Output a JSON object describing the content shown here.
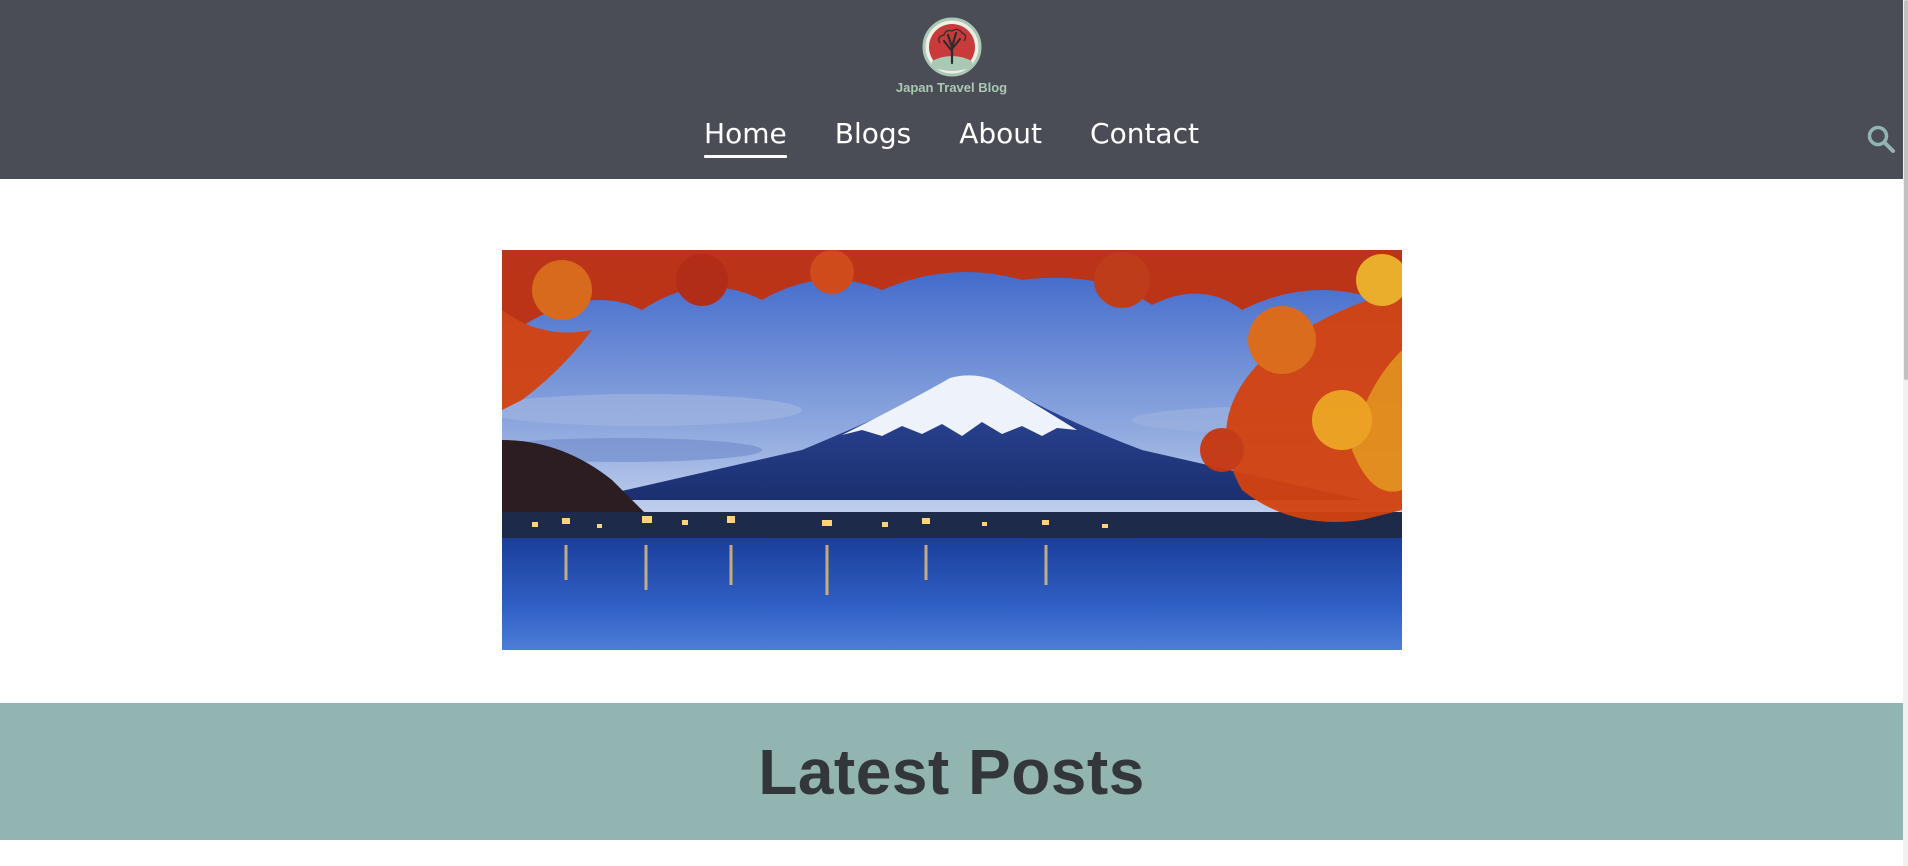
{
  "header": {
    "brand_name": "Japan Travel Blog",
    "logo_icon": "japan-tree-logo",
    "nav": [
      {
        "label": "Home",
        "active": true
      },
      {
        "label": "Blogs",
        "active": false
      },
      {
        "label": "About",
        "active": false
      },
      {
        "label": "Contact",
        "active": false
      }
    ],
    "search_icon": "search-icon"
  },
  "hero": {
    "image": "mount-fuji-autumn-lake"
  },
  "latest_posts": {
    "title": "Latest Posts"
  },
  "colors": {
    "header_bg": "#4a4d55",
    "accent_band": "#92b5b1",
    "brand_text": "#a9c9b5",
    "heading_text": "#33363b"
  }
}
